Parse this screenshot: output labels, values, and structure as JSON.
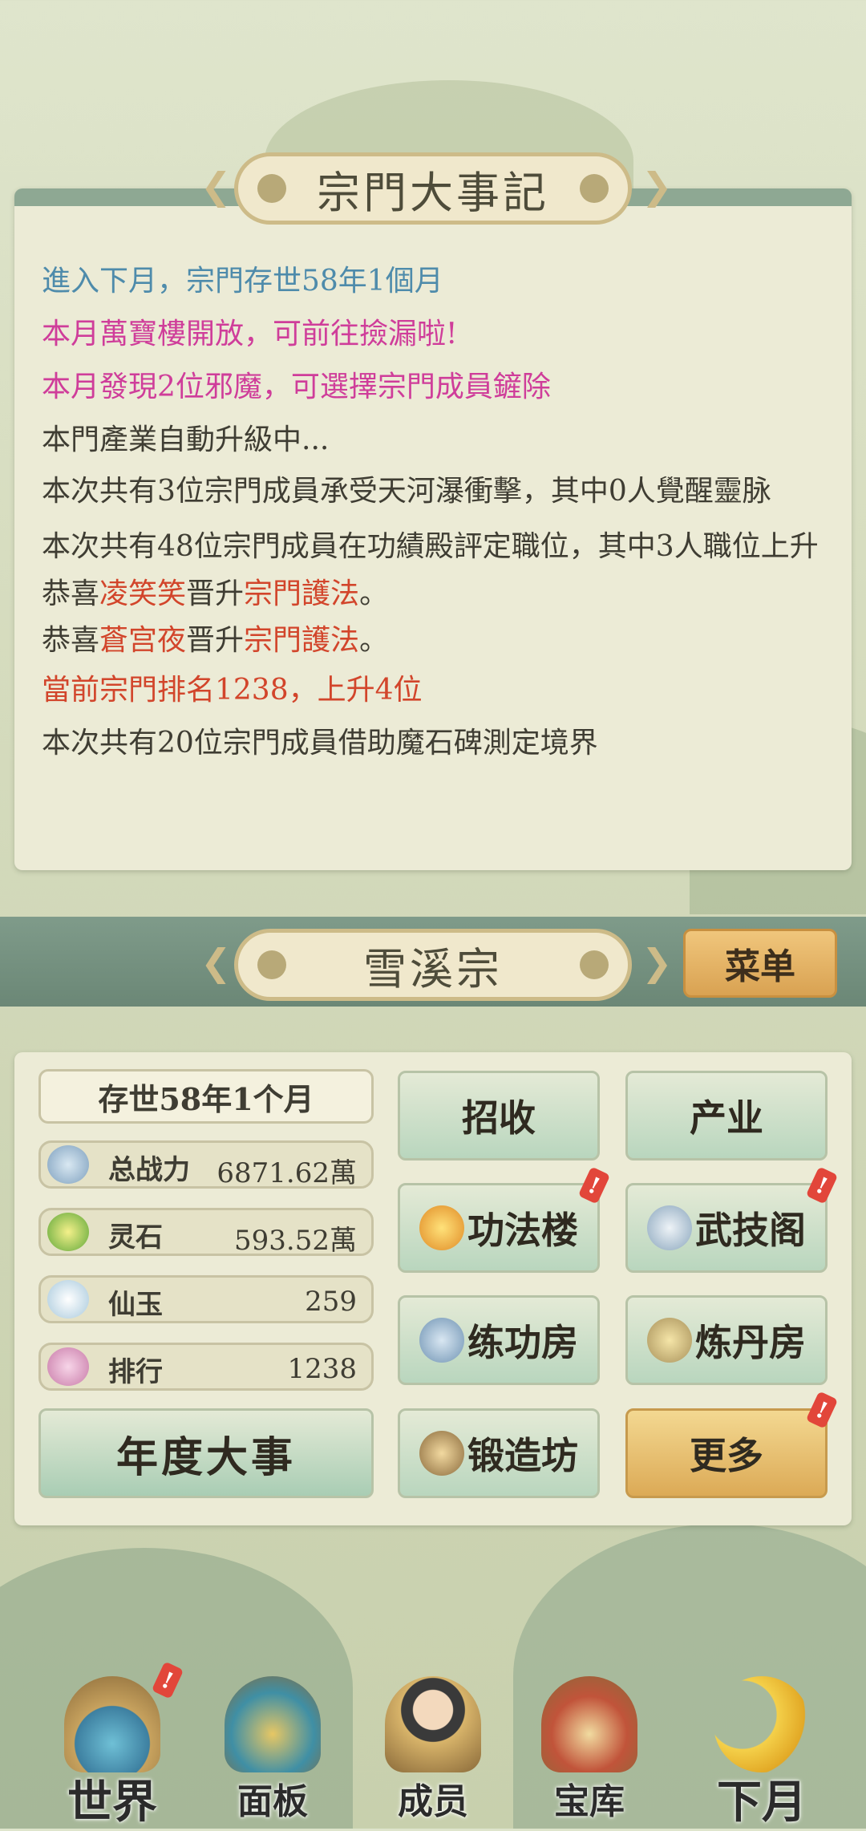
{
  "events_panel": {
    "title": "宗門大事記",
    "lines": [
      {
        "text": "進入下月，宗門存世58年1個月",
        "color": "blue"
      },
      {
        "text": "本月萬寶樓開放，可前往撿漏啦!",
        "color": "pink"
      },
      {
        "text": "本月發現2位邪魔，可選擇宗門成員鏟除",
        "color": "pink"
      },
      {
        "text": "本門產業自動升級中..."
      },
      {
        "text": "本次共有3位宗門成員承受天河瀑衝擊，其中0人覺醒靈脉"
      },
      {
        "text": "本次共有48位宗門成員在功績殿評定職位，其中3人職位上升"
      },
      {
        "parts": [
          "恭喜",
          "凌笑笑",
          "晋升",
          "宗門護法",
          "。"
        ]
      },
      {
        "parts": [
          "恭喜",
          "蒼宫夜",
          "晋升",
          "宗門護法",
          "。"
        ]
      },
      {
        "text": "當前宗門排名1238，上升4位",
        "color": "red"
      },
      {
        "text": "本次共有20位宗門成員借助魔石碑測定境界"
      }
    ]
  },
  "sect": {
    "name": "雪溪宗",
    "menu_label": "菜单"
  },
  "stats": {
    "existence": "存世58年1个月",
    "power_label": "总战力",
    "power_value": "6871.62萬",
    "stone_label": "灵石",
    "stone_value": "593.52萬",
    "jade_label": "仙玉",
    "jade_value": "259",
    "rank_label": "排行",
    "rank_value": "1238"
  },
  "buttons": {
    "recruit": "招收",
    "industry": "产业",
    "technique": "功法楼",
    "martial": "武技阁",
    "training": "练功房",
    "alchemy": "炼丹房",
    "forge": "锻造坊",
    "more": "更多",
    "annual": "年度大事",
    "badge": "!"
  },
  "nav": {
    "world": "世界",
    "panel": "面板",
    "members": "成员",
    "treasury": "宝库",
    "next_month": "下月"
  },
  "colors": {
    "accent_blue": "#4e8bab",
    "accent_pink": "#cf3d9a",
    "accent_red": "#d2452b",
    "gold": "#dcaa56"
  }
}
